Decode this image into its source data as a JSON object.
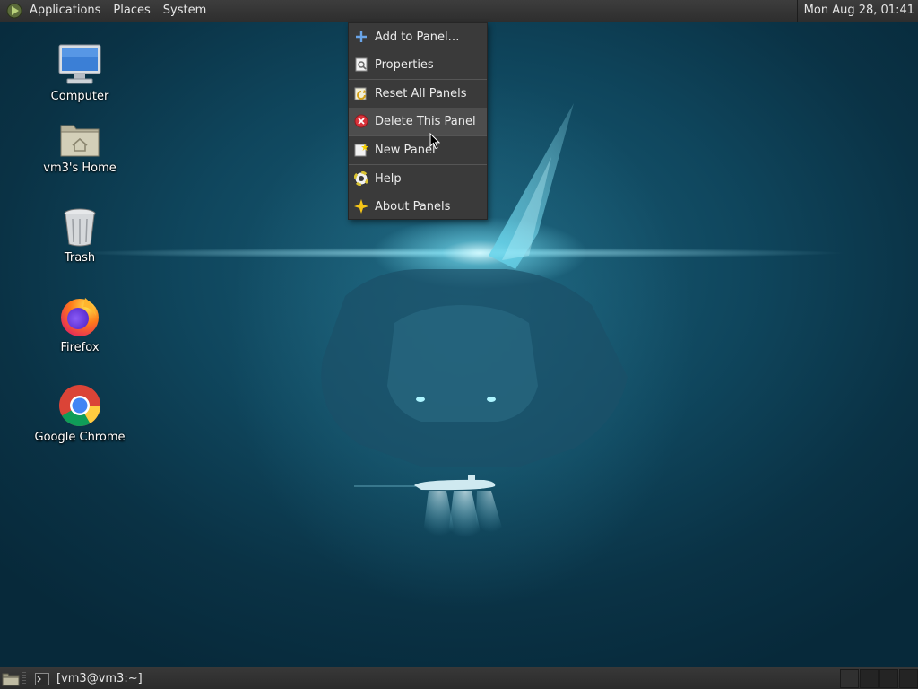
{
  "top_panel": {
    "menus": [
      "Applications",
      "Places",
      "System"
    ],
    "clock": "Mon Aug 28, 01:41"
  },
  "desktop_icons": [
    {
      "label": "Computer",
      "icon": "computer-icon"
    },
    {
      "label": "vm3's Home",
      "icon": "home-folder-icon"
    },
    {
      "label": "Trash",
      "icon": "trash-icon"
    },
    {
      "label": "Firefox",
      "icon": "firefox-icon"
    },
    {
      "label": "Google Chrome",
      "icon": "chrome-icon"
    }
  ],
  "context_menu": {
    "items": [
      {
        "label": "Add to Panel…",
        "icon": "plus-icon"
      },
      {
        "label": "Properties",
        "icon": "properties-icon"
      },
      {
        "label": "Reset All Panels",
        "icon": "reset-icon"
      },
      {
        "label": "Delete This Panel",
        "icon": "delete-icon",
        "highlighted": true
      },
      {
        "label": "New Panel",
        "icon": "new-panel-icon"
      },
      {
        "label": "Help",
        "icon": "help-icon"
      },
      {
        "label": "About Panels",
        "icon": "about-icon"
      }
    ]
  },
  "bottom_panel": {
    "task_label": "[vm3@vm3:~]",
    "workspaces": 4
  },
  "colors": {
    "panel_bg": "#333333",
    "menu_bg": "#3a3a3a",
    "menu_highlight": "#4d4d4d",
    "wallpaper_accent": "#7fe3f5"
  }
}
